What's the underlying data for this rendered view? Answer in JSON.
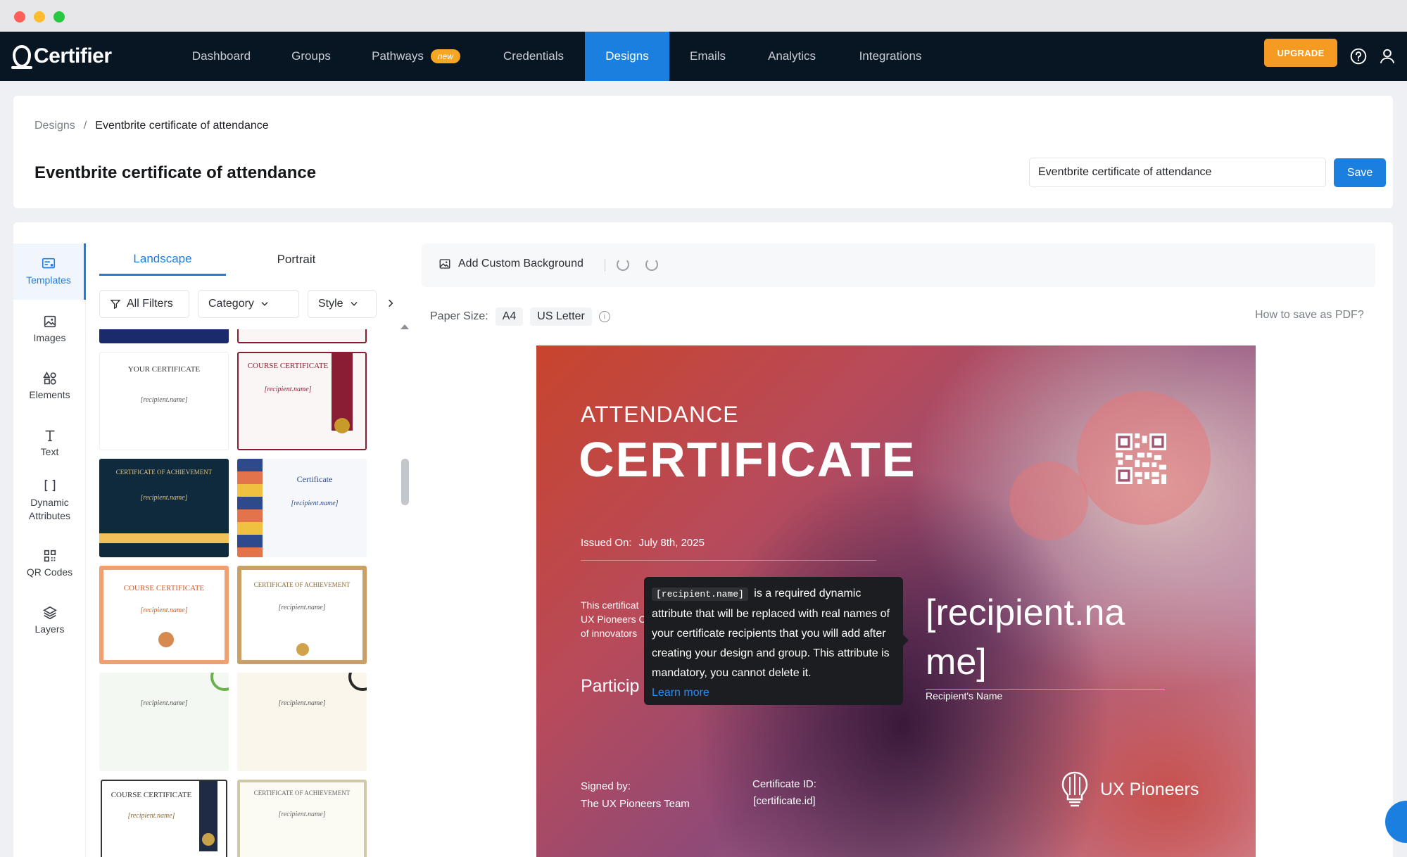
{
  "window": {
    "controls": [
      "close",
      "minimize",
      "maximize"
    ]
  },
  "nav": {
    "brand": "Certifier",
    "items": [
      {
        "label": "Dashboard"
      },
      {
        "label": "Groups"
      },
      {
        "label": "Pathways",
        "badge": "new"
      },
      {
        "label": "Credentials"
      },
      {
        "label": "Designs",
        "active": true
      },
      {
        "label": "Emails"
      },
      {
        "label": "Analytics"
      },
      {
        "label": "Integrations"
      }
    ],
    "upgrade_label": "UPGRADE",
    "help_icon": "question-circle-icon",
    "user_icon": "user-icon",
    "accent": "#1b7fe0",
    "upgrade_color": "#f59b23"
  },
  "header": {
    "breadcrumb_root": "Designs",
    "breadcrumb_sep": "/",
    "breadcrumb_current": "Eventbrite certificate of attendance",
    "title": "Eventbrite certificate of attendance",
    "name_value": "Eventbrite certificate of attendance",
    "save_label": "Save"
  },
  "sidebar": {
    "items": [
      {
        "label": "Templates",
        "icon": "templates-icon",
        "active": true
      },
      {
        "label": "Images",
        "icon": "image-icon"
      },
      {
        "label": "Elements",
        "icon": "shapes-icon"
      },
      {
        "label": "Text",
        "icon": "text-icon"
      },
      {
        "label": "Dynamic Attributes",
        "icon": "brackets-icon"
      },
      {
        "label": "QR Codes",
        "icon": "qr-code-icon"
      },
      {
        "label": "Layers",
        "icon": "layers-icon"
      }
    ]
  },
  "templates": {
    "tabs": [
      {
        "label": "Landscape",
        "active": true
      },
      {
        "label": "Portrait"
      }
    ],
    "filters": {
      "all": "All Filters",
      "category": "Category",
      "style": "Style"
    },
    "thumbnails": [
      {
        "title": "YOUR CERTIFICATE",
        "name": "[recipient.name]"
      },
      {
        "title": "COURSE CERTIFICATE",
        "name": "[recipient.name]"
      },
      {
        "title": "CERTIFICATE OF ACHIEVEMENT",
        "name": "[recipient.name]"
      },
      {
        "title": "Certificate",
        "name": "[recipient.name]"
      },
      {
        "title": "COURSE CERTIFICATE",
        "name": "[recipient.name]"
      },
      {
        "title": "CERTIFICATE OF ACHIEVEMENT",
        "name": "[recipient.name]"
      },
      {
        "title": "",
        "name": "[recipient.name]"
      },
      {
        "title": "",
        "name": "[recipient.name]"
      },
      {
        "title": "COURSE CERTIFICATE",
        "name": "[recipient.name]"
      },
      {
        "title": "CERTIFICATE OF ACHIEVEMENT",
        "name": "[recipient.name]"
      }
    ]
  },
  "toolbar": {
    "add_background": "Add Custom Background",
    "paper_size_label": "Paper Size:",
    "paper_a4": "A4",
    "paper_letter": "US Letter",
    "howto": "How to save as PDF?"
  },
  "certificate": {
    "heading_small": "ATTENDANCE",
    "heading_large": "CERTIFICATE",
    "issued_label": "Issued On:",
    "issued_date": "July 8th, 2025",
    "desc_line1": "This certificat",
    "desc_line2": "UX Pioneers C",
    "desc_line3": "of innovators",
    "participation": "Particip",
    "recipient": "[recipient.na me]",
    "recipient_label": "Recipient's Name",
    "signed_label": "Signed by:",
    "signed_value": "The UX Pioneers Team",
    "certid_label": "Certificate ID:",
    "certid_value": "[certificate.id]",
    "brand": "UX Pioneers"
  },
  "tooltip": {
    "code": "[recipient.name]",
    "text": "is a required dynamic attribute that will be replaced with real names of your certificate recipients that you will add after creating your design and group. This attribute is mandatory, you cannot delete it.",
    "link": "Learn more"
  }
}
